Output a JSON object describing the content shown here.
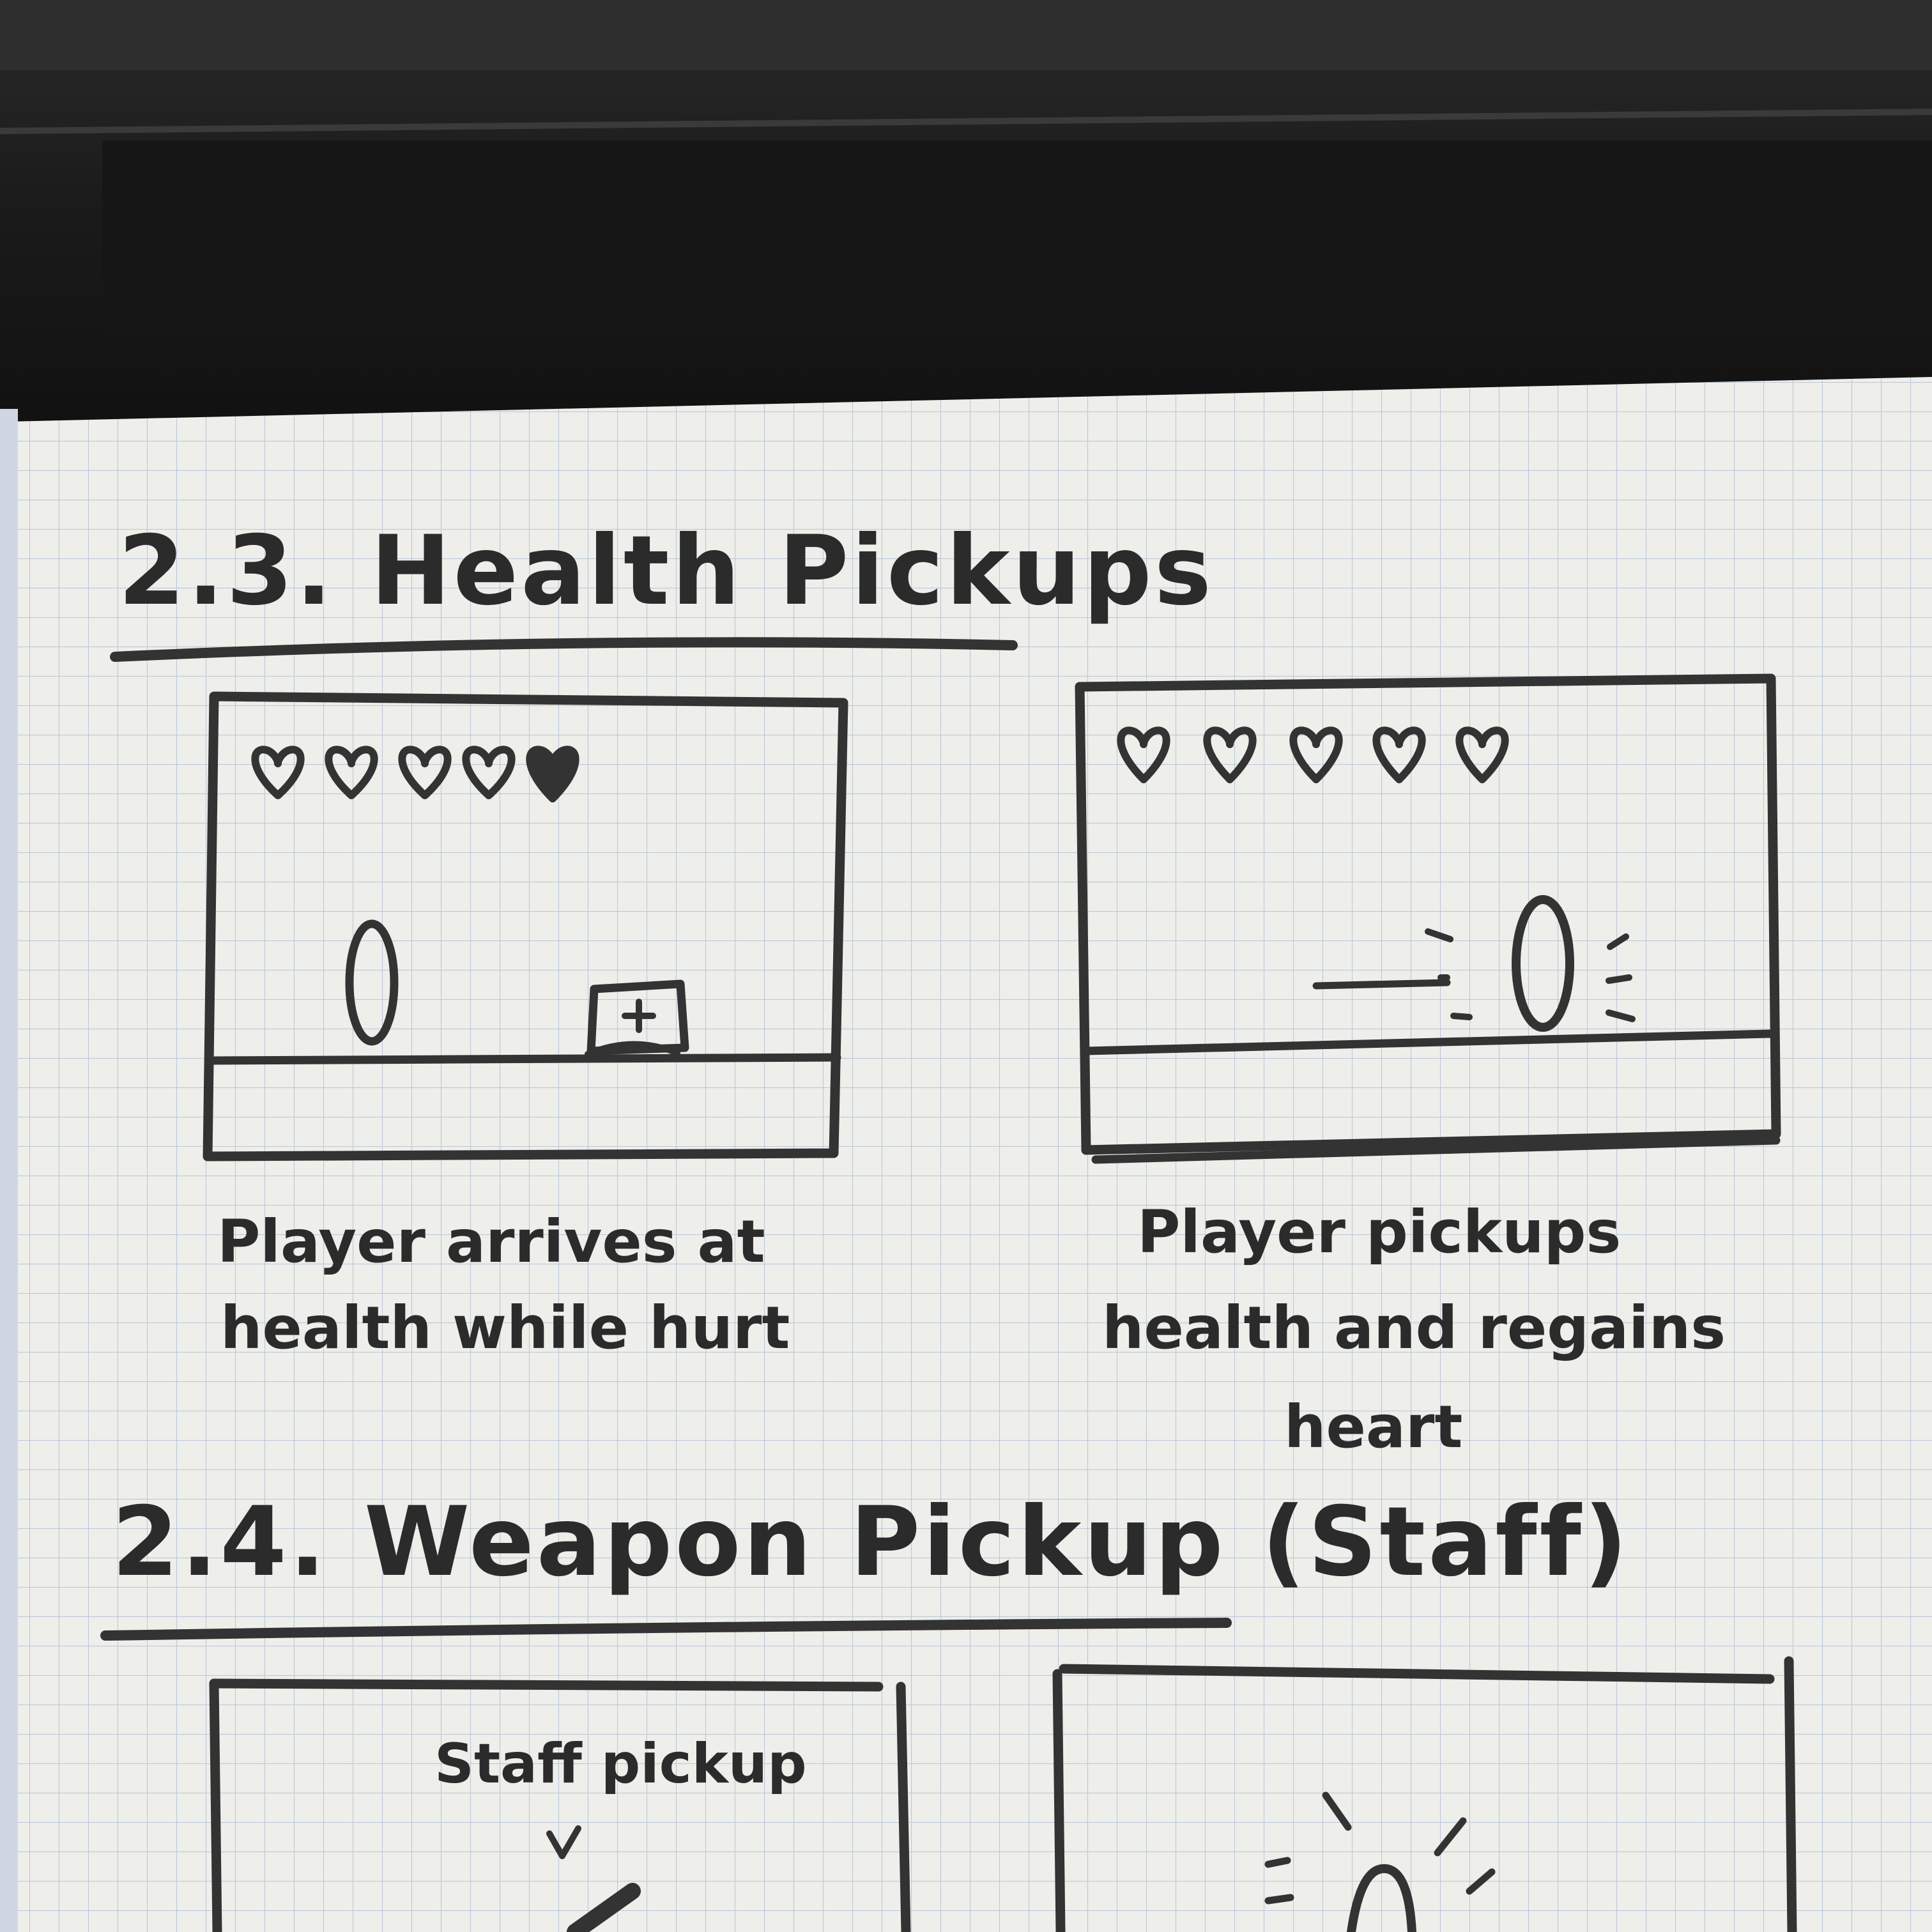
{
  "sections": [
    {
      "heading": "2.3. Health Pickups",
      "panels": [
        {
          "caption": [
            "Player arrives at",
            "health while hurt"
          ],
          "hearts_total": 5,
          "hearts_empty": 4
        },
        {
          "caption": [
            "Player pickups",
            "health and regains",
            "heart"
          ],
          "hearts_total": 5,
          "hearts_empty": 5
        }
      ]
    },
    {
      "heading": "2.4. Weapon Pickup (Staff)",
      "panels": [
        {
          "label": "Staff pickup"
        },
        {}
      ]
    }
  ],
  "colors": {
    "ink": "#333333",
    "paper": "#eeeeea",
    "grid": "#b9c6d6",
    "desk": "#1c1c1c"
  }
}
